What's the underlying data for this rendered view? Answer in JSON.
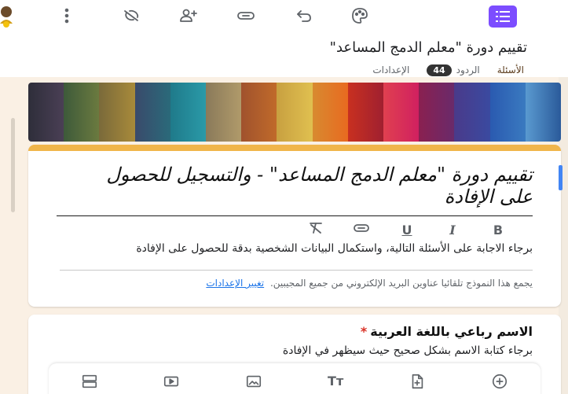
{
  "toolbar": {
    "icons": [
      "more-vert-icon",
      "palette-off-icon",
      "add-person-icon",
      "link-icon",
      "undo-icon",
      "palette-icon",
      "menu-icon"
    ],
    "accent": "#7c4dff"
  },
  "form": {
    "title": "تقييم دورة \"معلم الدمج المساعد\"",
    "tabs": {
      "questions": "الأسئلة",
      "responses": "الردود",
      "responses_count": "44",
      "settings": "الإعدادات"
    }
  },
  "header": {
    "title": "تقييم دورة \"معلم الدمج المساعد\" - والتسجيل للحصول على الإفادة",
    "format": {
      "bold": "B",
      "italic": "I",
      "underline": "U"
    },
    "description": "برجاء الاجابة على الأسئلة التالية، واستكمال البيانات الشخصية بدقة للحصول على الإفادة",
    "note": "يجمع هذا النموذج تلقائيا عناوين البريد الإلكتروني من جميع المجيبين.",
    "note_link": "تغيير الإعدادات",
    "accent": "#f0b54a"
  },
  "question": {
    "title": "الاسم رباعي باللغة العربية",
    "required_mark": "*",
    "description": "برجاء كتابة الاسم بشكل صحيح حيث سيظهر في الإفادة"
  },
  "bottom_bar": {
    "icons": [
      "section-icon",
      "video-icon",
      "image-icon",
      "title-icon",
      "import-icon",
      "add-question-icon"
    ],
    "title_label": "Tт"
  }
}
